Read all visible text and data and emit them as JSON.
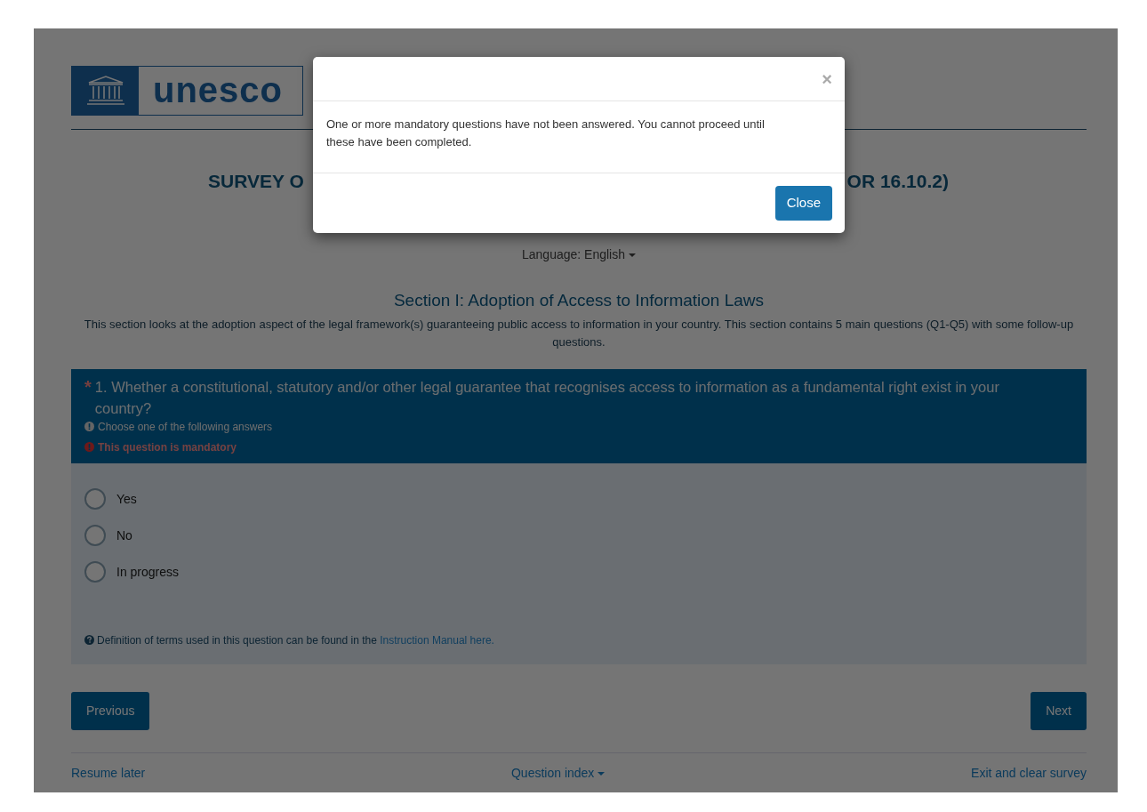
{
  "logo": {
    "wordmark": "unesco"
  },
  "title": {
    "left_visible": "SURVEY O",
    "right_visible": "OR 16.10.2)"
  },
  "language": {
    "label": "Language: English"
  },
  "section": {
    "title": "Section I: Adoption of Access to Information Laws",
    "description": "This section looks at the adoption aspect of the legal framework(s) guaranteeing public access to information in your country. This section contains 5 main questions (Q1-Q5) with some follow-up questions."
  },
  "question": {
    "required_mark": "*",
    "text": "1. Whether a constitutional, statutory and/or other legal guarantee that recognises access to information as a fundamental right exist in your country?",
    "hint": "Choose one of the following answers",
    "error": "This question is mandatory",
    "options": [
      {
        "label": "Yes",
        "selected": false
      },
      {
        "label": "No",
        "selected": false
      },
      {
        "label": "In progress",
        "selected": false
      }
    ],
    "help_text": "Definition of terms used in this question can be found in the",
    "help_link": "Instruction Manual here."
  },
  "nav_buttons": [
    {
      "label": "Previous"
    },
    {
      "label": "Next"
    }
  ],
  "footer": {
    "left": "Resume later",
    "center": "Question index",
    "right": "Exit and clear survey"
  },
  "modal": {
    "close_symbol": "×",
    "message": "One or more mandatory questions have not been answered. You cannot proceed until these have been completed.",
    "button": "Close"
  }
}
